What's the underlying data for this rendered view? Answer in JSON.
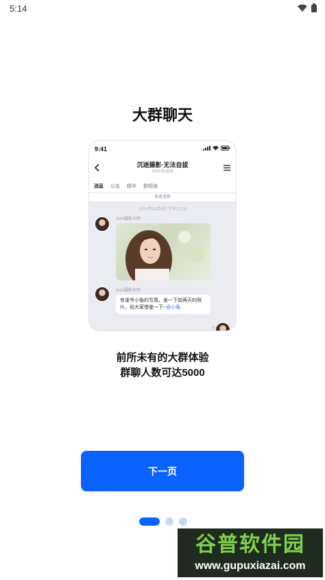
{
  "status": {
    "time": "5:14"
  },
  "title": "大群聊天",
  "mockup": {
    "time": "9:41",
    "group_name": "沉迷摄影·无法自拔",
    "members": "5000名成员",
    "tabs": [
      "消息",
      "公告",
      "精华",
      "群频道"
    ],
    "notice": "未读消息",
    "timestamp": "2024年04月8日 下午12:18",
    "sender1": "AAA摄影大师",
    "sender2": "AAA摄影大师",
    "message": "有谁爷小兔的写真，发一下前两天的照片，给大家借鉴一下~",
    "mention": "@小兔",
    "me": "小兔"
  },
  "subtitle_line1": "前所未有的大群体验",
  "subtitle_line2": "群聊人数可达5000",
  "next_label": "下一页",
  "pager": {
    "pages": 3,
    "current": 1
  },
  "watermark": {
    "top": "谷普软件园",
    "bottom": "www.gupuxiazai.com"
  },
  "colors": {
    "accent": "#0a63ff",
    "dot_inactive": "#c7d8fb"
  }
}
